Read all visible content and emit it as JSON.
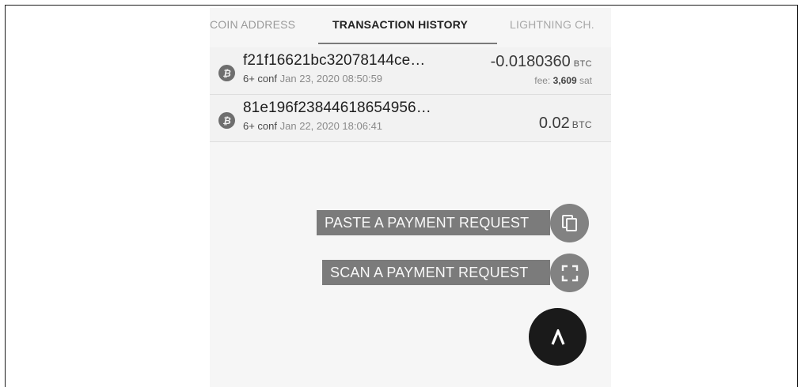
{
  "tabs": [
    {
      "label": "COIN ADDRESS"
    },
    {
      "label": "TRANSACTION HISTORY",
      "active": true
    },
    {
      "label": "LIGHTNING CH."
    }
  ],
  "transactions": [
    {
      "txid": "f21f16621bc32078144ce…",
      "conf": "6+ conf",
      "date": "Jan 23, 2020 08:50:59",
      "amount": "-0.0180360",
      "unit": "BTC",
      "fee_prefix": "fee:",
      "fee_value": "3,609",
      "fee_unit": "sat"
    },
    {
      "txid": "81e196f23844618654956…",
      "conf": "6+ conf",
      "date": "Jan 22, 2020 18:06:41",
      "amount": "0.02",
      "unit": "BTC"
    }
  ],
  "actions": {
    "paste_label": "PASTE A PAYMENT REQUEST",
    "scan_label": "SCAN A PAYMENT REQUEST"
  },
  "icons": {
    "coin": "bitcoin-icon",
    "paste": "copy-icon",
    "scan": "scan-frame-icon",
    "main_fab": "chevron-up-icon"
  },
  "colors": {
    "fab_dark": "#1a1a1a",
    "mini_fab": "#828282",
    "label_bg": "#7b7b7b"
  }
}
